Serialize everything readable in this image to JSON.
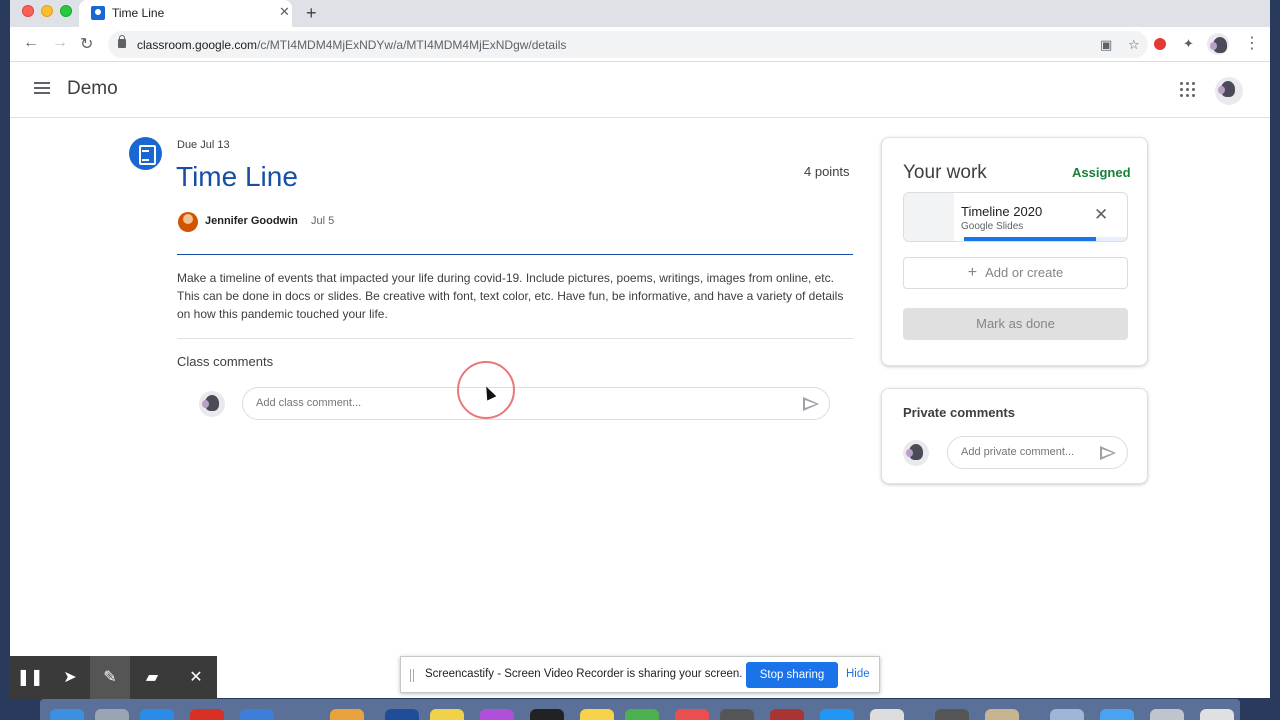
{
  "browser": {
    "tab_title": "Time Line",
    "tab_close": "✕",
    "new_tab": "+",
    "url_host": "classroom.google.com",
    "url_path": "/c/MTI4MDM4MjExNDYw/a/MTI4MDM4MjExNDgw/details"
  },
  "app": {
    "class_name": "Demo"
  },
  "assignment": {
    "due": "Due Jul 13",
    "title": "Time Line",
    "points": "4 points",
    "author": "Jennifer Goodwin",
    "posted": "Jul 5",
    "description": "Make a timeline of events that impacted your life during covid-19. Include pictures, poems, writings, images from online, etc. This can be done in docs or slides. Be creative with font, text color, etc. Have fun, be informative, and have a variety of details on how this pandemic touched your life.",
    "class_comments_label": "Class comments",
    "class_comment_placeholder": "Add class comment..."
  },
  "your_work": {
    "title": "Your work",
    "status": "Assigned",
    "status_color": "#188038",
    "file_name": "Timeline 2020",
    "file_type": "Google Slides",
    "file_progress_percent": 80,
    "add_label": "Add or create",
    "mark_done_label": "Mark as done"
  },
  "private_comments": {
    "title": "Private comments",
    "placeholder": "Add private comment..."
  },
  "screencastify": {
    "message": "Screencastify - Screen Video Recorder is sharing your screen.",
    "stop_label": "Stop sharing",
    "hide_label": "Hide"
  },
  "recorder_controls": {
    "pause": "❚❚",
    "pointer": "➤",
    "pen": "✎",
    "highlighter": "▰",
    "close": "✕"
  },
  "colors": {
    "accent": "#1967d2",
    "title": "#174ea6",
    "share_button": "#1a73e8"
  }
}
